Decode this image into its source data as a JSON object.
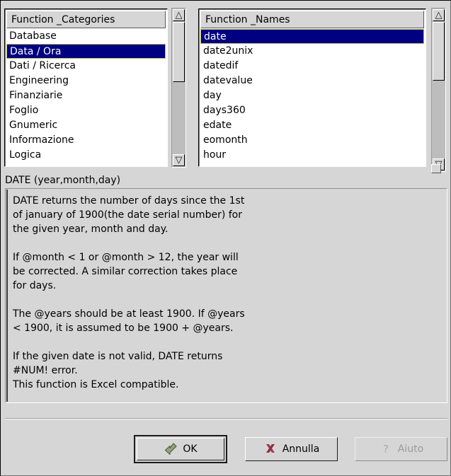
{
  "colors": {
    "window_bg": "#d6d6d6",
    "list_bg": "#ffffff",
    "selection_bg": "#000080",
    "selection_fg": "#ffffff",
    "focus_border": "#bdb76b",
    "ok_icon": "#8b9c72",
    "cancel_icon": "#a03a4a",
    "disabled_text": "#9b9b9b"
  },
  "categories_list": {
    "header": "Function _Categories",
    "items": [
      "Database",
      "Data / Ora",
      "Dati / Ricerca",
      "Engineering",
      "Finanziarie",
      "Foglio",
      "Gnumeric",
      "Informazione",
      "Logica"
    ],
    "selected_index": 1,
    "scrollbar": {
      "up_arrow": "△",
      "down_arrow": "▽",
      "thumb_top_pct": 0,
      "thumb_height_pct": 45
    }
  },
  "names_list": {
    "header": "Function _Names",
    "items": [
      "date",
      "date2unix",
      "datedif",
      "datevalue",
      "day",
      "days360",
      "edate",
      "eomonth",
      "hour"
    ],
    "selected_index": 0,
    "scrollbar": {
      "up_arrow": "△",
      "down_arrow": "▽",
      "thumb_top_pct": 0,
      "thumb_height_pct": 43
    }
  },
  "description": {
    "title": "DATE (year,month,day)",
    "lines": [
      "DATE returns the number of days since the 1st",
      "of january of 1900(the date serial number) for",
      "the given year, month and day.",
      "",
      "If @month < 1 or @month > 12, the year will",
      "be corrected. A similar correction takes place",
      "for days.",
      "",
      "The @years should be at least 1900. If @years",
      "< 1900, it is assumed to be 1900 + @years.",
      "",
      "If the given date is not valid, DATE returns",
      "#NUM! error.",
      "This function is Excel compatible."
    ]
  },
  "buttons": {
    "ok": {
      "label": "OK",
      "icon": "enter-arrow-icon",
      "enabled": true,
      "is_default": true
    },
    "cancel": {
      "label": "Annulla",
      "icon": "red-x-icon",
      "enabled": true,
      "is_default": false
    },
    "help": {
      "label": "Aiuto",
      "icon": "question-mark-icon",
      "enabled": false,
      "is_default": false
    }
  }
}
